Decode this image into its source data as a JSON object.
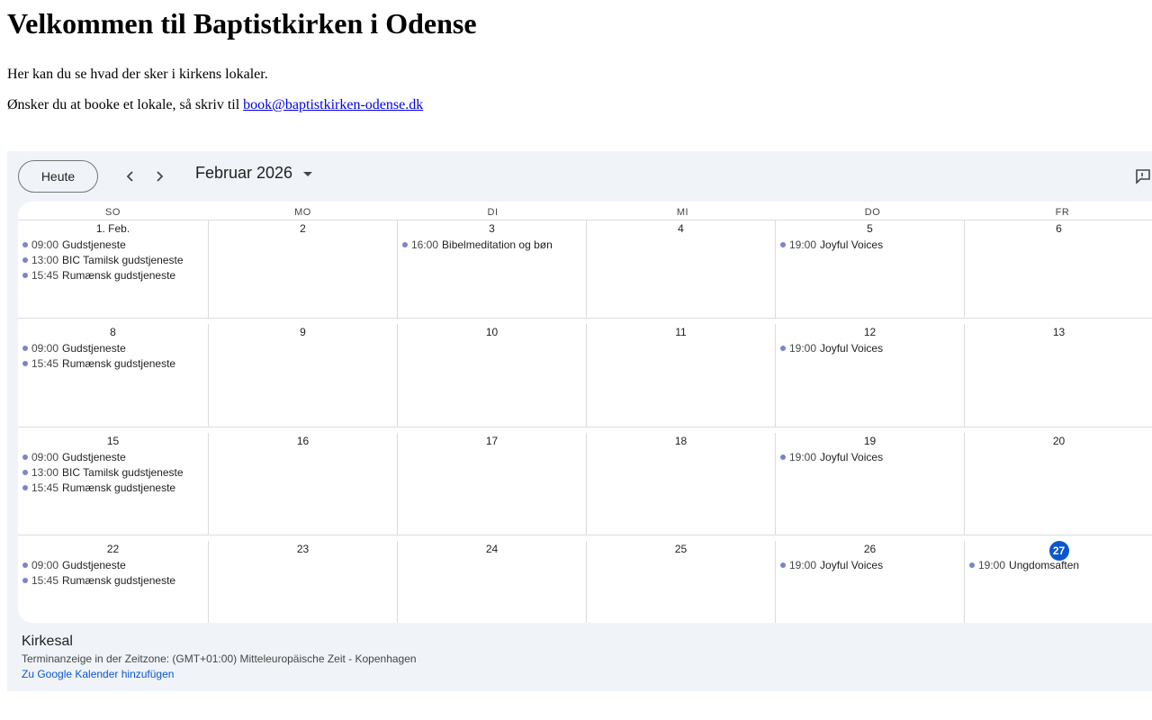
{
  "page": {
    "title": "Velkommen til Baptistkirken i Odense",
    "intro": "Her kan du se hvad der sker i kirkens lokaler.",
    "booking_text": "Ønsker du at booke et lokale, så skriv til ",
    "booking_email": "book@baptistkirken-odense.dk"
  },
  "calendar": {
    "today_label": "Heute",
    "month_label": "Februar 2026",
    "weekdays": [
      "SO",
      "MO",
      "DI",
      "MI",
      "DO",
      "FR"
    ],
    "event_color": "#7986cb",
    "today_color": "#0b57d0",
    "weeks": [
      [
        {
          "day": "1. Feb.",
          "events": [
            {
              "time": "09:00",
              "title": "Gudstjeneste"
            },
            {
              "time": "13:00",
              "title": "BIC Tamilsk gudstjeneste"
            },
            {
              "time": "15:45",
              "title": "Rumænsk gudstjeneste"
            }
          ]
        },
        {
          "day": "2",
          "events": []
        },
        {
          "day": "3",
          "events": [
            {
              "time": "16:00",
              "title": "Bibelmeditation og bøn"
            }
          ]
        },
        {
          "day": "4",
          "events": []
        },
        {
          "day": "5",
          "events": [
            {
              "time": "19:00",
              "title": "Joyful Voices"
            }
          ]
        },
        {
          "day": "6",
          "events": []
        }
      ],
      [
        {
          "day": "8",
          "events": [
            {
              "time": "09:00",
              "title": "Gudstjeneste"
            },
            {
              "time": "15:45",
              "title": "Rumænsk gudstjeneste"
            }
          ]
        },
        {
          "day": "9",
          "events": []
        },
        {
          "day": "10",
          "events": []
        },
        {
          "day": "11",
          "events": []
        },
        {
          "day": "12",
          "events": [
            {
              "time": "19:00",
              "title": "Joyful Voices"
            }
          ]
        },
        {
          "day": "13",
          "events": []
        }
      ],
      [
        {
          "day": "15",
          "events": [
            {
              "time": "09:00",
              "title": "Gudstjeneste"
            },
            {
              "time": "13:00",
              "title": "BIC Tamilsk gudstjeneste"
            },
            {
              "time": "15:45",
              "title": "Rumænsk gudstjeneste"
            }
          ]
        },
        {
          "day": "16",
          "events": []
        },
        {
          "day": "17",
          "events": []
        },
        {
          "day": "18",
          "events": []
        },
        {
          "day": "19",
          "events": [
            {
              "time": "19:00",
              "title": "Joyful Voices"
            }
          ]
        },
        {
          "day": "20",
          "events": []
        }
      ],
      [
        {
          "day": "22",
          "events": [
            {
              "time": "09:00",
              "title": "Gudstjeneste"
            },
            {
              "time": "15:45",
              "title": "Rumænsk gudstjeneste"
            }
          ]
        },
        {
          "day": "23",
          "events": []
        },
        {
          "day": "24",
          "events": []
        },
        {
          "day": "25",
          "events": []
        },
        {
          "day": "26",
          "events": [
            {
              "time": "19:00",
              "title": "Joyful Voices"
            }
          ]
        },
        {
          "day": "27",
          "today": true,
          "events": [
            {
              "time": "19:00",
              "title": "Ungdomsaften"
            }
          ]
        }
      ]
    ],
    "footer": {
      "calendar_name": "Kirkesal",
      "timezone_text": "Terminanzeige in der Zeitzone: (GMT+01:00) Mitteleuropäische Zeit - Kopenhagen",
      "add_link": "Zu Google Kalender hinzufügen"
    }
  }
}
